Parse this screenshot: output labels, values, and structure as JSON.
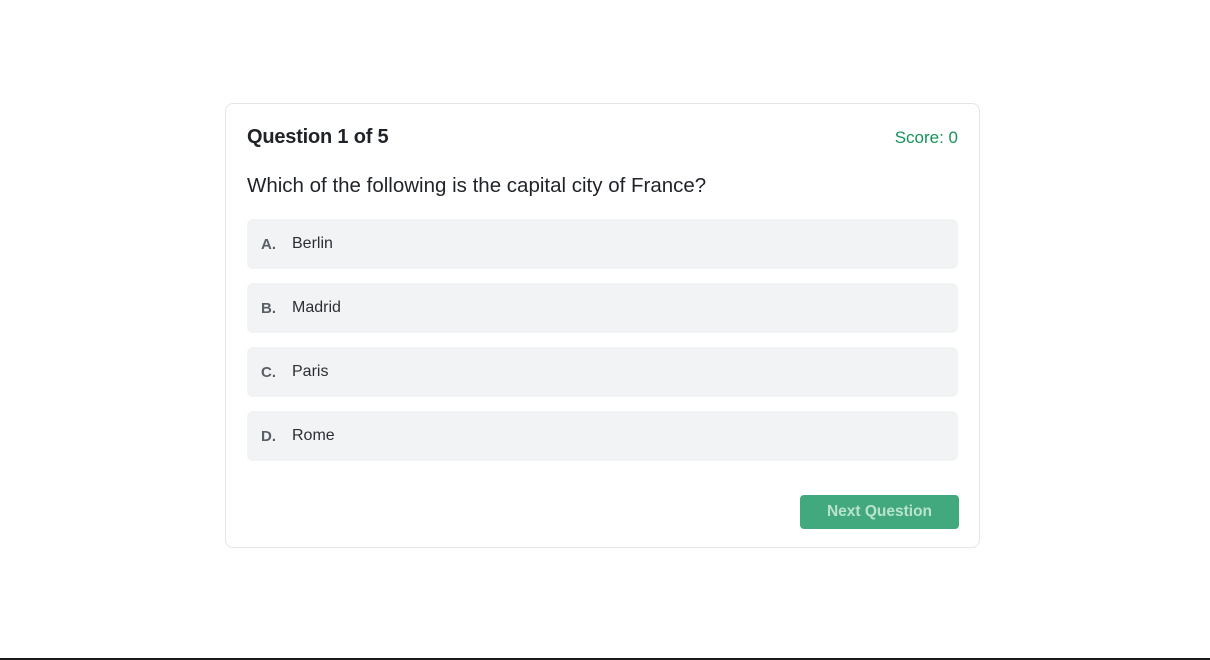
{
  "quiz": {
    "question_counter": "Question 1 of 5",
    "score_label": "Score: 0",
    "question": "Which of the following is the capital city of France?",
    "options": [
      {
        "letter": "A.",
        "text": "Berlin"
      },
      {
        "letter": "B.",
        "text": "Madrid"
      },
      {
        "letter": "C.",
        "text": "Paris"
      },
      {
        "letter": "D.",
        "text": "Rome"
      }
    ],
    "next_button_label": "Next Question"
  },
  "colors": {
    "accent": "#42a87e",
    "score": "#16935a",
    "option_bg": "#f2f3f5",
    "border": "#e3e5e8"
  }
}
